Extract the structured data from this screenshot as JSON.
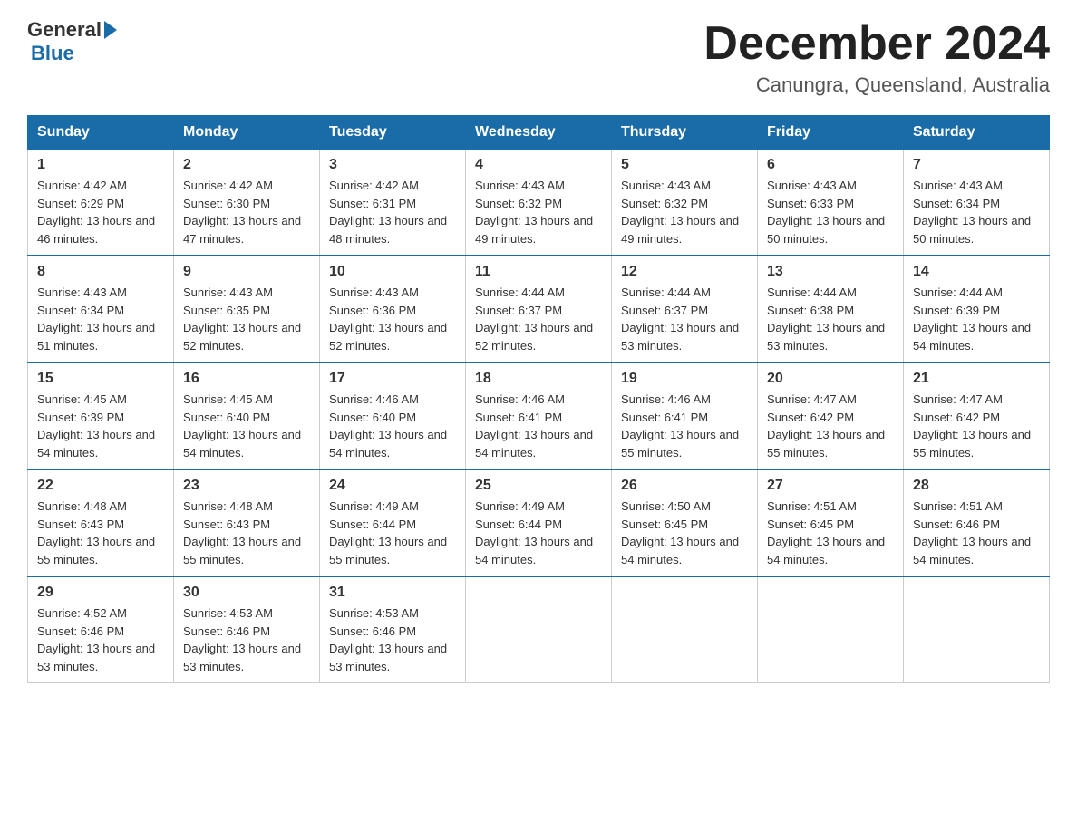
{
  "header": {
    "logo_general": "General",
    "logo_blue": "Blue",
    "title": "December 2024",
    "subtitle": "Canungra, Queensland, Australia"
  },
  "days_of_week": [
    "Sunday",
    "Monday",
    "Tuesday",
    "Wednesday",
    "Thursday",
    "Friday",
    "Saturday"
  ],
  "weeks": [
    [
      {
        "day": "1",
        "sunrise": "4:42 AM",
        "sunset": "6:29 PM",
        "daylight": "13 hours and 46 minutes."
      },
      {
        "day": "2",
        "sunrise": "4:42 AM",
        "sunset": "6:30 PM",
        "daylight": "13 hours and 47 minutes."
      },
      {
        "day": "3",
        "sunrise": "4:42 AM",
        "sunset": "6:31 PM",
        "daylight": "13 hours and 48 minutes."
      },
      {
        "day": "4",
        "sunrise": "4:43 AM",
        "sunset": "6:32 PM",
        "daylight": "13 hours and 49 minutes."
      },
      {
        "day": "5",
        "sunrise": "4:43 AM",
        "sunset": "6:32 PM",
        "daylight": "13 hours and 49 minutes."
      },
      {
        "day": "6",
        "sunrise": "4:43 AM",
        "sunset": "6:33 PM",
        "daylight": "13 hours and 50 minutes."
      },
      {
        "day": "7",
        "sunrise": "4:43 AM",
        "sunset": "6:34 PM",
        "daylight": "13 hours and 50 minutes."
      }
    ],
    [
      {
        "day": "8",
        "sunrise": "4:43 AM",
        "sunset": "6:34 PM",
        "daylight": "13 hours and 51 minutes."
      },
      {
        "day": "9",
        "sunrise": "4:43 AM",
        "sunset": "6:35 PM",
        "daylight": "13 hours and 52 minutes."
      },
      {
        "day": "10",
        "sunrise": "4:43 AM",
        "sunset": "6:36 PM",
        "daylight": "13 hours and 52 minutes."
      },
      {
        "day": "11",
        "sunrise": "4:44 AM",
        "sunset": "6:37 PM",
        "daylight": "13 hours and 52 minutes."
      },
      {
        "day": "12",
        "sunrise": "4:44 AM",
        "sunset": "6:37 PM",
        "daylight": "13 hours and 53 minutes."
      },
      {
        "day": "13",
        "sunrise": "4:44 AM",
        "sunset": "6:38 PM",
        "daylight": "13 hours and 53 minutes."
      },
      {
        "day": "14",
        "sunrise": "4:44 AM",
        "sunset": "6:39 PM",
        "daylight": "13 hours and 54 minutes."
      }
    ],
    [
      {
        "day": "15",
        "sunrise": "4:45 AM",
        "sunset": "6:39 PM",
        "daylight": "13 hours and 54 minutes."
      },
      {
        "day": "16",
        "sunrise": "4:45 AM",
        "sunset": "6:40 PM",
        "daylight": "13 hours and 54 minutes."
      },
      {
        "day": "17",
        "sunrise": "4:46 AM",
        "sunset": "6:40 PM",
        "daylight": "13 hours and 54 minutes."
      },
      {
        "day": "18",
        "sunrise": "4:46 AM",
        "sunset": "6:41 PM",
        "daylight": "13 hours and 54 minutes."
      },
      {
        "day": "19",
        "sunrise": "4:46 AM",
        "sunset": "6:41 PM",
        "daylight": "13 hours and 55 minutes."
      },
      {
        "day": "20",
        "sunrise": "4:47 AM",
        "sunset": "6:42 PM",
        "daylight": "13 hours and 55 minutes."
      },
      {
        "day": "21",
        "sunrise": "4:47 AM",
        "sunset": "6:42 PM",
        "daylight": "13 hours and 55 minutes."
      }
    ],
    [
      {
        "day": "22",
        "sunrise": "4:48 AM",
        "sunset": "6:43 PM",
        "daylight": "13 hours and 55 minutes."
      },
      {
        "day": "23",
        "sunrise": "4:48 AM",
        "sunset": "6:43 PM",
        "daylight": "13 hours and 55 minutes."
      },
      {
        "day": "24",
        "sunrise": "4:49 AM",
        "sunset": "6:44 PM",
        "daylight": "13 hours and 55 minutes."
      },
      {
        "day": "25",
        "sunrise": "4:49 AM",
        "sunset": "6:44 PM",
        "daylight": "13 hours and 54 minutes."
      },
      {
        "day": "26",
        "sunrise": "4:50 AM",
        "sunset": "6:45 PM",
        "daylight": "13 hours and 54 minutes."
      },
      {
        "day": "27",
        "sunrise": "4:51 AM",
        "sunset": "6:45 PM",
        "daylight": "13 hours and 54 minutes."
      },
      {
        "day": "28",
        "sunrise": "4:51 AM",
        "sunset": "6:46 PM",
        "daylight": "13 hours and 54 minutes."
      }
    ],
    [
      {
        "day": "29",
        "sunrise": "4:52 AM",
        "sunset": "6:46 PM",
        "daylight": "13 hours and 53 minutes."
      },
      {
        "day": "30",
        "sunrise": "4:53 AM",
        "sunset": "6:46 PM",
        "daylight": "13 hours and 53 minutes."
      },
      {
        "day": "31",
        "sunrise": "4:53 AM",
        "sunset": "6:46 PM",
        "daylight": "13 hours and 53 minutes."
      },
      null,
      null,
      null,
      null
    ]
  ]
}
